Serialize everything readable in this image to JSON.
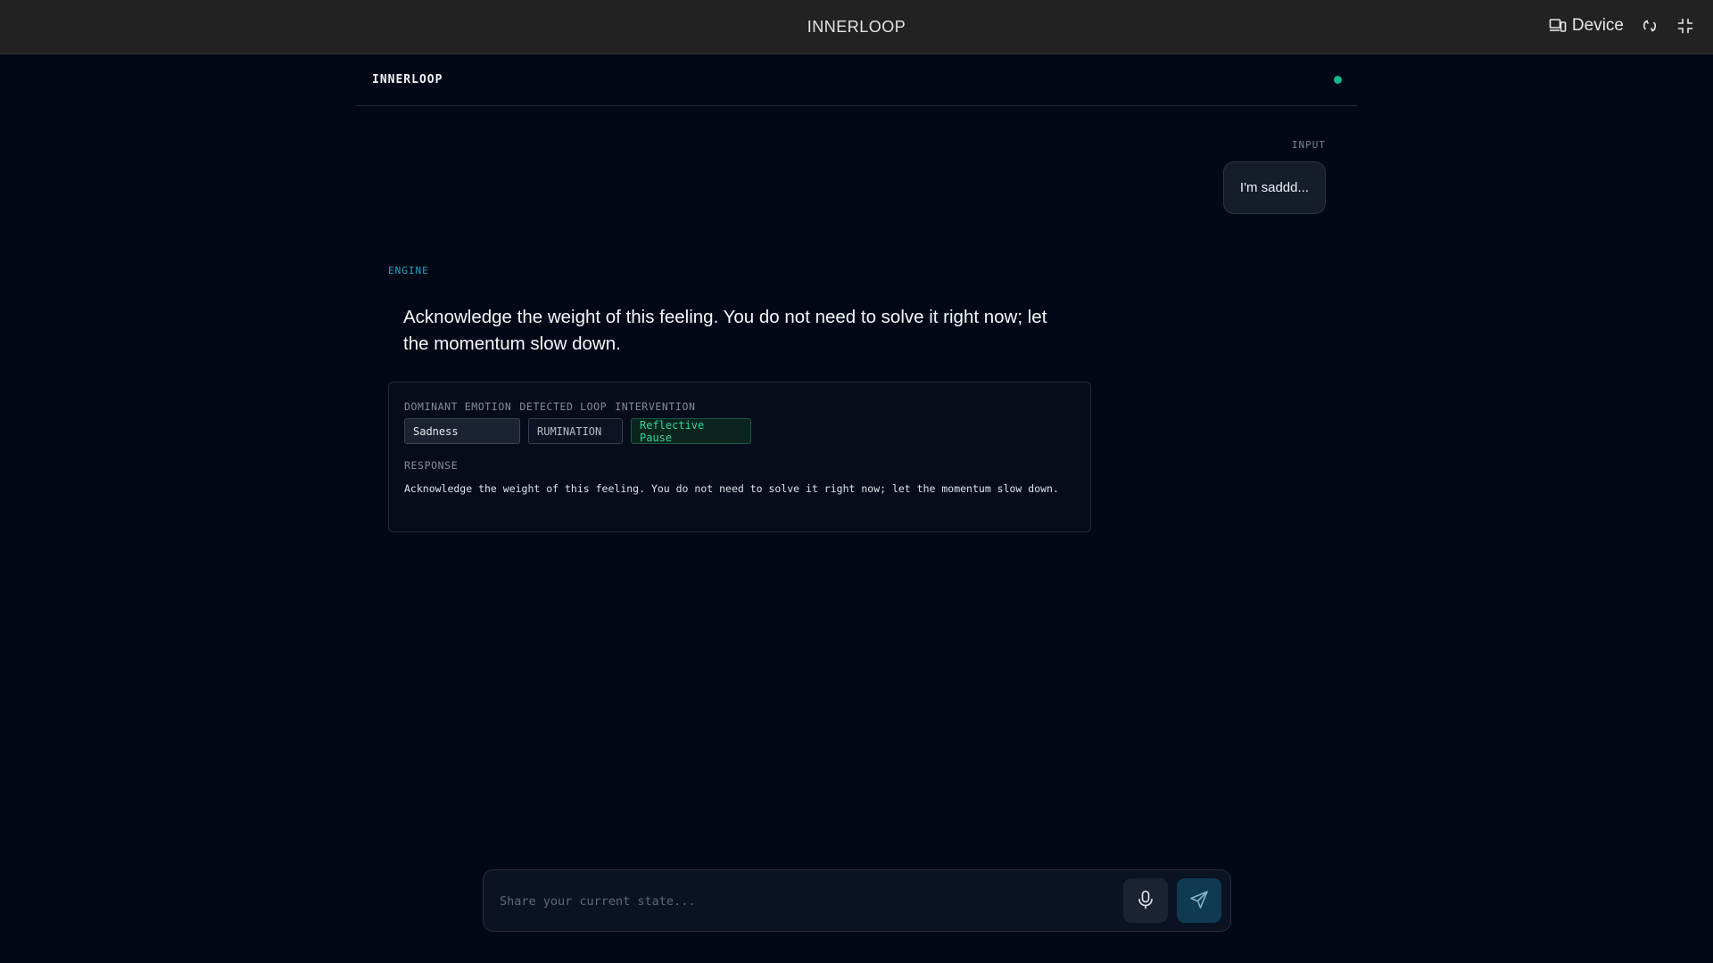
{
  "topbar": {
    "title": "INNERLOOP",
    "device_label": "Device",
    "icons": [
      "device-icon",
      "rotate-icon",
      "fullscreen-icon"
    ]
  },
  "app": {
    "brand": "INNERLOOP",
    "status_color": "#14b887"
  },
  "conversation": {
    "user": {
      "label": "INPUT",
      "message": "I'm saddd..."
    },
    "engine": {
      "label": "ENGINE",
      "message": "Acknowledge the weight of this feeling. You do not need to solve it right now; let the momentum slow down."
    }
  },
  "analysis": {
    "labels": {
      "emotion": "DOMINANT EMOTION",
      "loop": "DETECTED LOOP",
      "intervention": "INTERVENTION",
      "response": "RESPONSE"
    },
    "emotion": "Sadness",
    "loop": "RUMINATION",
    "intervention": "Reflective Pause",
    "response": "Acknowledge the weight of this feeling. You do not need to solve it right now; let the momentum slow down."
  },
  "composer": {
    "placeholder": "Share your current state...",
    "value": "",
    "icons": [
      "microphone-icon",
      "send-icon"
    ]
  },
  "colors": {
    "background": "#030817",
    "accent_engine": "#22a6c4",
    "intervention": "#33d69b",
    "send_button": "#0e3b52"
  }
}
